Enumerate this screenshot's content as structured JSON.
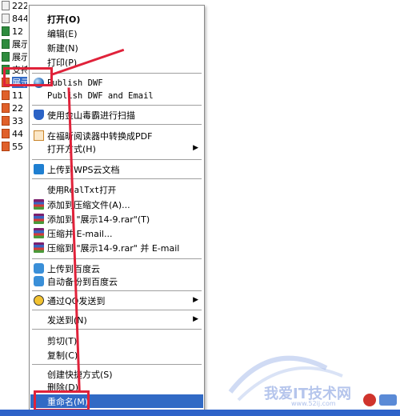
{
  "file_list": [
    {
      "name": "222",
      "type": "txt"
    },
    {
      "name": "844",
      "type": "txt"
    },
    {
      "name": "12",
      "type": "xls"
    },
    {
      "name": "展示",
      "type": "xls"
    },
    {
      "name": "展示",
      "type": "xls"
    },
    {
      "name": "支持",
      "type": "xls"
    },
    {
      "name": "展示",
      "type": "ppt",
      "selected": true
    },
    {
      "name": "11",
      "type": "ppt"
    },
    {
      "name": "22",
      "type": "ppt"
    },
    {
      "name": "33",
      "type": "ppt"
    },
    {
      "name": "44",
      "type": "ppt"
    },
    {
      "name": "55",
      "type": "ppt"
    }
  ],
  "menu": {
    "open": "打开(O)",
    "edit": "编辑(E)",
    "new": "新建(N)",
    "print": "打印(P)",
    "publish_dwf": "Publish DWF",
    "publish_dwf_email": "Publish DWF and Email",
    "kingsoft_scan": "使用金山毒霸进行扫描",
    "foxit_pdf": "在福昕阅读器中转换成PDF",
    "open_with": "打开方式(H)",
    "wps_upload": "上传到WPS云文档",
    "realtxt": "使用RealTxt打开",
    "add_archive": "添加到压缩文件(A)...",
    "add_rar": "添加到 \"展示14-9.rar\"(T)",
    "compress_email": "压缩并 E-mail...",
    "compress_rar_email": "压缩到 \"展示14-9.rar\" 并 E-mail",
    "baidu_upload": "上传到百度云",
    "baidu_backup": "自动备份到百度云",
    "qq_send": "通过QQ发送到",
    "send_to": "发送到(N)",
    "cut": "剪切(T)",
    "copy": "复制(C)",
    "create_shortcut": "创建快捷方式(S)",
    "delete": "删除(D)",
    "rename": "重命名(M)"
  },
  "icons": {
    "publish_dwf": "globe-icon",
    "kingsoft": "shield-icon",
    "foxit": "pdf-icon",
    "wps": "cloud-icon",
    "rar": "archive-icon",
    "baidu": "cloud-icon",
    "qq": "penguin-icon"
  },
  "watermark": {
    "text": "我爱IT技术网",
    "url": "www.52ij.com"
  },
  "colors": {
    "highlight": "#316ac5",
    "annotation": "#e0223a"
  }
}
